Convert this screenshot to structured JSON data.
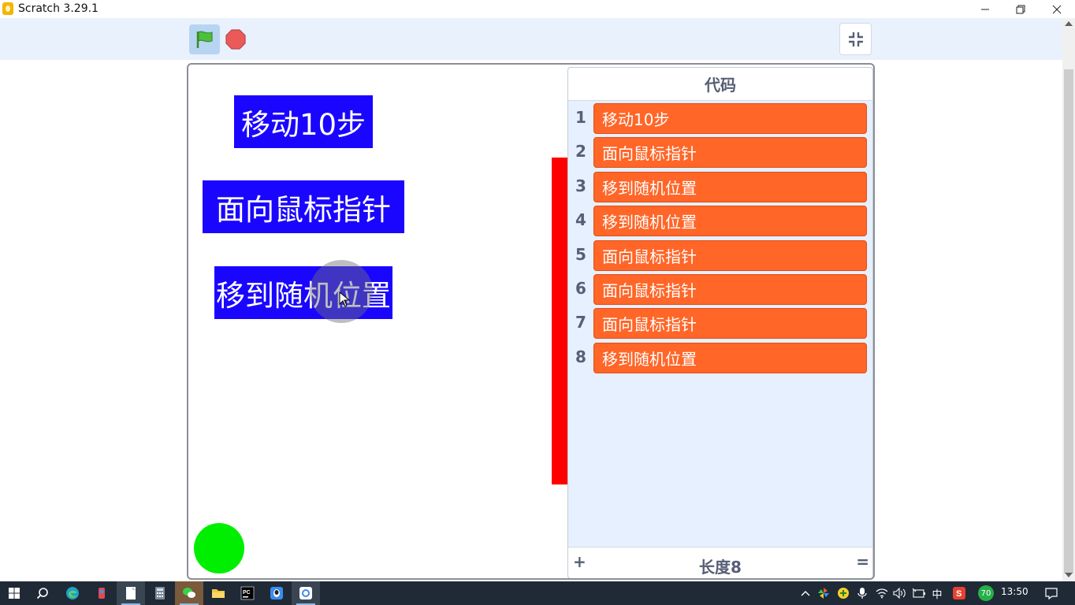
{
  "window": {
    "title": "Scratch 3.29.1",
    "minimize_icon": "minimize-icon",
    "maximize_icon": "restore-icon",
    "close_icon": "close-icon"
  },
  "toolbar": {
    "green_flag_icon": "green-flag-icon",
    "stop_icon": "stop-icon",
    "fullscreen_icon": "exit-fullscreen-icon"
  },
  "stage": {
    "sprites": [
      {
        "text": "移动10步"
      },
      {
        "text": "面向鼠标指针"
      },
      {
        "text": "移到随机位置"
      }
    ],
    "colors": {
      "sprite_bg": "#1a06ff",
      "bar": "#ff0000",
      "ball": "#00ee00"
    }
  },
  "list_monitor": {
    "title": "代码",
    "items": [
      {
        "index": "1",
        "value": "移动10步"
      },
      {
        "index": "2",
        "value": "面向鼠标指针"
      },
      {
        "index": "3",
        "value": "移到随机位置"
      },
      {
        "index": "4",
        "value": "移到随机位置"
      },
      {
        "index": "5",
        "value": "面向鼠标指针"
      },
      {
        "index": "6",
        "value": "面向鼠标指针"
      },
      {
        "index": "7",
        "value": "面向鼠标指针"
      },
      {
        "index": "8",
        "value": "移到随机位置"
      }
    ],
    "add_label": "+",
    "length_label": "长度8",
    "resize_label": "=",
    "item_color": "#ff6628"
  },
  "taskbar": {
    "items": [
      "windows-start-icon",
      "search-icon",
      "edge-icon",
      "scratch-cat-icon",
      "notepad-icon",
      "calculator-icon",
      "wechat-icon",
      "file-explorer-icon",
      "pycharm-icon",
      "qq-icon",
      "scratch-app-icon"
    ],
    "tray": {
      "ime_label": "中",
      "badge": "70",
      "time": "13:50"
    }
  }
}
